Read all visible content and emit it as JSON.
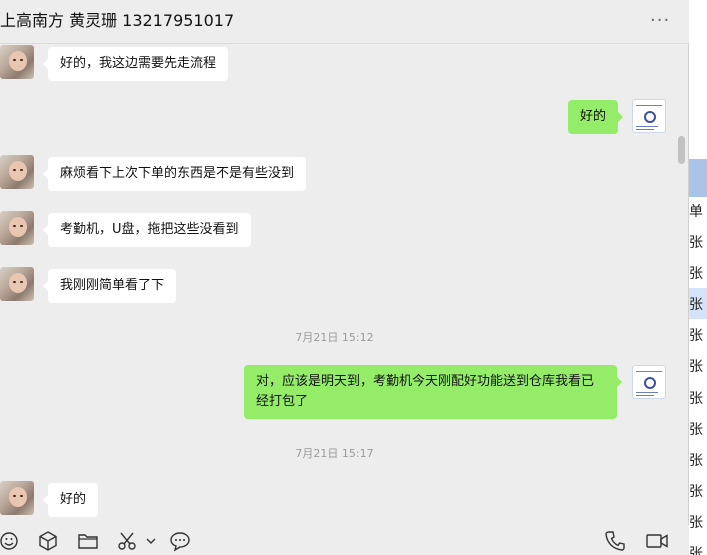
{
  "header": {
    "title": "上高南方 黄灵珊 13217951017",
    "more_label": "···"
  },
  "messages": [
    {
      "direction": "in",
      "text": "好的，我这边需要先走流程"
    },
    {
      "direction": "out",
      "text": "好的"
    },
    {
      "direction": "in",
      "text": "麻烦看下上次下单的东西是不是有些没到"
    },
    {
      "direction": "in",
      "text": "考勤机，U盘，拖把这些没看到"
    },
    {
      "direction": "in",
      "text": "我刚刚简单看了下"
    },
    {
      "direction": "time",
      "text": "7月21日 15:12"
    },
    {
      "direction": "out",
      "text": "对，应该是明天到，考勤机今天刚配好功能送到仓库我看已经打包了"
    },
    {
      "direction": "time",
      "text": "7月21日 15:17"
    },
    {
      "direction": "in",
      "text": "好的"
    }
  ],
  "toolbar": {
    "icons": [
      "emoji-icon",
      "cube-icon",
      "folder-icon",
      "scissors-icon",
      "chevron-down-icon",
      "chat-bubble-icon",
      "phone-icon",
      "video-icon"
    ]
  },
  "side_list": [
    {
      "label": ""
    },
    {
      "label": "单"
    },
    {
      "label": "张"
    },
    {
      "label": "张"
    },
    {
      "label": "张"
    },
    {
      "label": "张"
    },
    {
      "label": "张"
    },
    {
      "label": "张"
    },
    {
      "label": "张"
    },
    {
      "label": "张"
    },
    {
      "label": "张"
    },
    {
      "label": "张"
    },
    {
      "label": "张"
    },
    {
      "label": "张"
    }
  ],
  "colors": {
    "incoming_bubble": "#ffffff",
    "outgoing_bubble": "#95ec69",
    "background": "#ededed",
    "timestamp_text": "#9a9a9a",
    "side_selected": "#a9c4e8"
  }
}
